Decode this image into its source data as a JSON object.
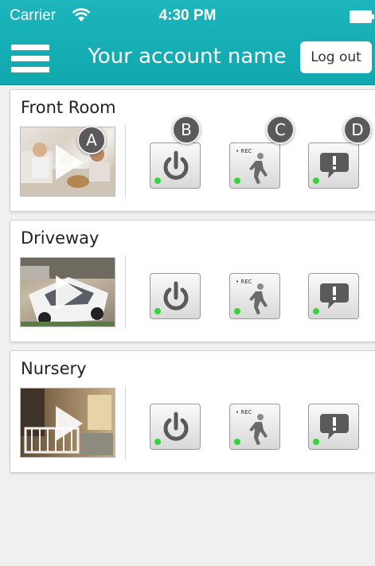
{
  "status_bar": {
    "carrier": "Carrier",
    "time": "4:30 PM"
  },
  "header": {
    "title": "Your account name",
    "logout_label": "Log out"
  },
  "colors": {
    "accent": "#14adb4",
    "status_dot": "#3bd13b",
    "badge": "#5a5a5a"
  },
  "cameras": [
    {
      "name": "Front Room",
      "icons": [
        "power-icon",
        "motion-record-icon",
        "alert-icon"
      ]
    },
    {
      "name": "Driveway",
      "icons": [
        "power-icon",
        "motion-record-icon",
        "alert-icon"
      ]
    },
    {
      "name": "Nursery",
      "icons": [
        "power-icon",
        "motion-record-icon",
        "alert-icon"
      ]
    }
  ],
  "rec_label": "• REC",
  "annotations": [
    "A",
    "B",
    "C",
    "D"
  ]
}
